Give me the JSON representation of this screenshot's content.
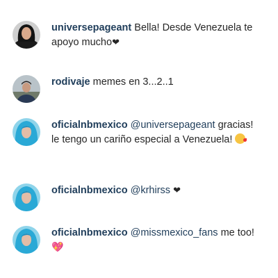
{
  "comments": [
    {
      "username": "universepageant",
      "text": "Bella! Desde Venezuela te apoyo mucho",
      "emoji": "❤",
      "avatar": "avatar-woman-dark-hair"
    },
    {
      "username": "rodivaje",
      "text": "memes en 3...2..1",
      "avatar": "avatar-man-outdoors"
    },
    {
      "username": "oficialnbmexico",
      "mention": "@universepageant",
      "text": "gracias! le tengo un cariño especial a Venezuela!",
      "emoji": "kiss-face",
      "avatar": "avatar-blue-hair"
    },
    {
      "username": "oficialnbmexico",
      "mention": "@krhirss",
      "emoji": "❤",
      "avatar": "avatar-blue-hair"
    },
    {
      "username": "oficialnbmexico",
      "mention": "@missmexico_fans",
      "text": "me too!",
      "emoji": "💖",
      "avatar": "avatar-blue-hair"
    }
  ],
  "colors": {
    "username": "#1f3d5a",
    "text": "#262626",
    "pink_heart": "#e8538e"
  }
}
